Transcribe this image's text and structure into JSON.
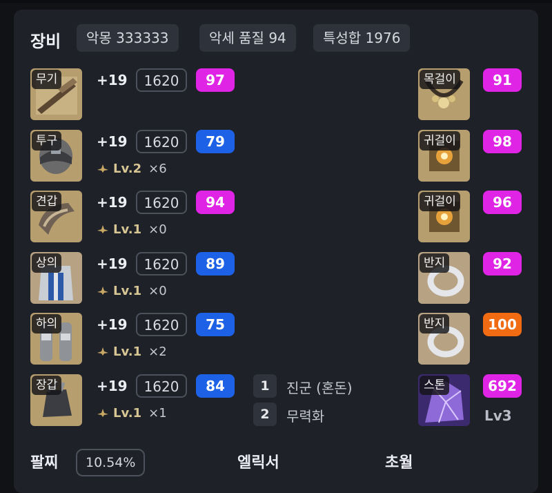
{
  "section_title": "장비",
  "tags": [
    "악몽 333333",
    "악세 품질 94",
    "특성합 1976"
  ],
  "equipment": [
    {
      "label": "무기",
      "plus": "+19",
      "level": "1620",
      "quality": "97",
      "quality_color": "#e024e6"
    },
    {
      "label": "투구",
      "plus": "+19",
      "level": "1620",
      "quality": "79",
      "quality_color": "#1d62e6",
      "elixir_level": "Lv.2",
      "elixir_count": "×6"
    },
    {
      "label": "견갑",
      "plus": "+19",
      "level": "1620",
      "quality": "94",
      "quality_color": "#e024e6",
      "elixir_level": "Lv.1",
      "elixir_count": "×0"
    },
    {
      "label": "상의",
      "plus": "+19",
      "level": "1620",
      "quality": "89",
      "quality_color": "#1d62e6",
      "elixir_level": "Lv.1",
      "elixir_count": "×0"
    },
    {
      "label": "하의",
      "plus": "+19",
      "level": "1620",
      "quality": "75",
      "quality_color": "#1d62e6",
      "elixir_level": "Lv.1",
      "elixir_count": "×2"
    },
    {
      "label": "장갑",
      "plus": "+19",
      "level": "1620",
      "quality": "84",
      "quality_color": "#1d62e6",
      "elixir_level": "Lv.1",
      "elixir_count": "×1"
    }
  ],
  "accessories": [
    {
      "label": "목걸이",
      "quality": "91",
      "quality_color": "#e024e6"
    },
    {
      "label": "귀걸이",
      "quality": "98",
      "quality_color": "#e024e6"
    },
    {
      "label": "귀걸이",
      "quality": "96",
      "quality_color": "#e024e6"
    },
    {
      "label": "반지",
      "quality": "92",
      "quality_color": "#e024e6"
    },
    {
      "label": "반지",
      "quality": "100",
      "quality_color": "#f06b12"
    },
    {
      "label": "스톤",
      "quality": "692",
      "quality_color": "#e024e6",
      "sub": "Lv3"
    }
  ],
  "transcendence": [
    {
      "num": "1",
      "text": "진군 (혼돈)"
    },
    {
      "num": "2",
      "text": "무력화"
    }
  ],
  "bottom": {
    "bracelet_title": "팔찌",
    "bracelet_pct": "10.54%",
    "elixir_title": "엘릭서",
    "transcend_title": "초월"
  }
}
